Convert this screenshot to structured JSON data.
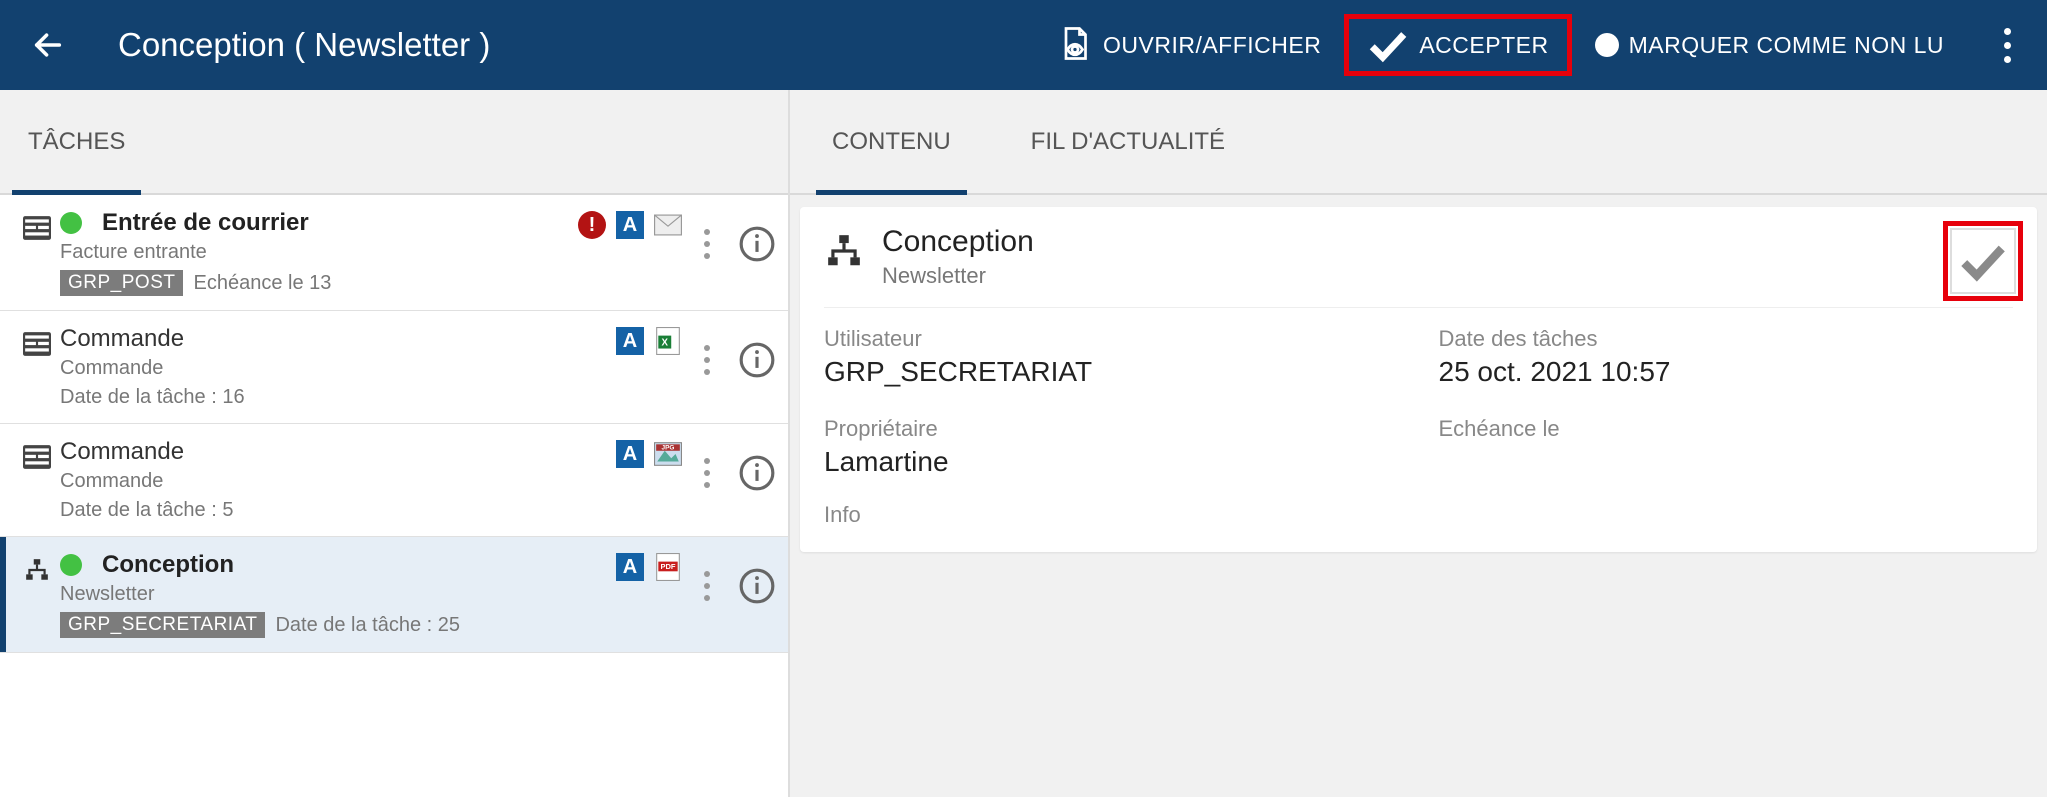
{
  "header": {
    "title": "Conception ( Newsletter )",
    "actions": {
      "open_label": "OUVRIR/AFFICHER",
      "accept_label": "ACCEPTER",
      "mark_unread_label": "MARQUER COMME NON LU"
    }
  },
  "left_panel": {
    "tab_label": "TÂCHES"
  },
  "tasks": [
    {
      "title": "Entrée de courrier",
      "bold": true,
      "status_dot": true,
      "subtitle": "Facture entrante",
      "chip": "GRP_POST",
      "date_text": "Echéance le 13",
      "alert": true,
      "a_badge": true,
      "file_type": "mail"
    },
    {
      "title": "Commande",
      "bold": false,
      "status_dot": false,
      "subtitle": "Commande",
      "chip": "",
      "date_text": "Date de la tâche : 16",
      "alert": false,
      "a_badge": true,
      "file_type": "xls"
    },
    {
      "title": "Commande",
      "bold": false,
      "status_dot": false,
      "subtitle": "Commande",
      "chip": "",
      "date_text": "Date de la tâche : 5",
      "alert": false,
      "a_badge": true,
      "file_type": "jpg"
    },
    {
      "title": "Conception",
      "bold": true,
      "status_dot": true,
      "subtitle": "Newsletter",
      "chip": "GRP_SECRETARIAT",
      "date_text": "Date de la tâche : 25",
      "alert": false,
      "a_badge": true,
      "file_type": "pdf",
      "selected": true
    }
  ],
  "right_panel": {
    "tabs": {
      "content_label": "CONTENU",
      "feed_label": "FIL D'ACTUALITÉ"
    },
    "detail": {
      "title": "Conception",
      "subtitle": "Newsletter",
      "fields": {
        "user_label": "Utilisateur",
        "user_value": "GRP_SECRETARIAT",
        "task_date_label": "Date des tâches",
        "task_date_value": "25 oct. 2021 10:57",
        "owner_label": "Propriétaire",
        "owner_value": "Lamartine",
        "due_label": "Echéance le",
        "due_value": "",
        "info_label": "Info"
      }
    }
  }
}
